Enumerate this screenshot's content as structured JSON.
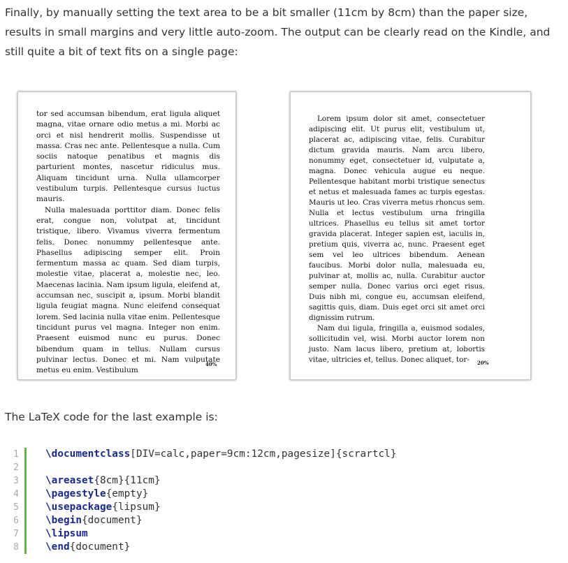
{
  "intro_text": "Finally, by manually setting the text area to be a bit smaller (11cm by 8cm) than the paper size, results in small margins and very little auto-zoom. The output can be clearly read on the Kindle, and still quite a bit of text fits on a single page:",
  "left_page": {
    "paragraphs": [
      {
        "text": "tor sed accumsan bibendum, erat ligula aliquet magna, vitae ornare odio metus a mi. Morbi ac orci et nisl hendrerit mollis. Suspendisse ut massa. Cras nec ante. Pellentesque a nulla. Cum sociis natoque penatibus et magnis dis parturient montes, nascetur ridiculus mus. Aliquam tincidunt urna. Nulla ullamcorper vestibulum turpis. Pellentesque cursus luctus mauris.",
        "indent": false
      },
      {
        "text": "Nulla malesuada porttitor diam. Donec felis erat, congue non, volutpat at, tincidunt tristique, libero. Vivamus viverra fermentum felis. Donec nonummy pellentesque ante. Phasellus adipiscing semper elit. Proin fermentum massa ac quam. Sed diam turpis, molestie vitae, placerat a, molestie nec, leo. Maecenas lacinia. Nam ipsum ligula, eleifend at, accumsan nec, suscipit a, ipsum. Morbi blandit ligula feugiat magna. Nunc eleifend consequat lorem. Sed lacinia nulla vitae enim. Pellentesque tincidunt purus vel magna. Integer non enim. Praesent euismod nunc eu purus. Donec bibendum quam in tellus. Nullam cursus pulvinar lectus. Donec et mi. Nam vulputate metus eu enim. Vestibulum",
        "indent": true
      }
    ],
    "page_number": "40%"
  },
  "right_page": {
    "paragraphs": [
      {
        "text": "Lorem ipsum dolor sit amet, consectetuer adipiscing elit. Ut purus elit, vestibulum ut, placerat ac, adipiscing vitae, felis. Curabitur dictum gravida mauris. Nam arcu libero, nonummy eget, consectetuer id, vulputate a, magna. Donec vehicula augue eu neque. Pellentesque habitant morbi tristique senectus et netus et malesuada fames ac turpis egestas. Mauris ut leo. Cras viverra metus rhoncus sem. Nulla et lectus vestibulum urna fringilla ultrices. Phasellus eu tellus sit amet tortor gravida placerat. Integer sapien est, iaculis in, pretium quis, viverra ac, nunc. Praesent eget sem vel leo ultrices bibendum. Aenean faucibus. Morbi dolor nulla, malesuada eu, pulvinar at, mollis ac, nulla. Curabitur auctor semper nulla. Donec varius orci eget risus. Duis nibh mi, congue eu, accumsan eleifend, sagittis quis, diam. Duis eget orci sit amet orci dignissim rutrum.",
        "indent": true
      },
      {
        "text": "Nam dui ligula, fringilla a, euismod sodales, sollicitudin vel, wisi. Morbi auctor lorem non justo. Nam lacus libero, pretium at, lobortis vitae, ultricies et, tellus. Donec aliquet, tor-",
        "indent": true
      }
    ],
    "page_number": "20%"
  },
  "subheading": "The LaTeX code for the last example is:",
  "code_lines": [
    {
      "n": "1",
      "cmd": "\\documentclass",
      "rest": "[DIV=calc,paper=9cm:12cm,pagesize]{scrartcl}"
    },
    {
      "n": "2",
      "cmd": "",
      "rest": ""
    },
    {
      "n": "3",
      "cmd": "\\areaset",
      "rest": "{8cm}{11cm}"
    },
    {
      "n": "4",
      "cmd": "\\pagestyle",
      "rest": "{empty}"
    },
    {
      "n": "5",
      "cmd": "\\usepackage",
      "rest": "{lipsum}"
    },
    {
      "n": "6",
      "cmd": "\\begin",
      "rest": "{document}"
    },
    {
      "n": "7",
      "cmd": "\\lipsum",
      "rest": ""
    },
    {
      "n": "8",
      "cmd": "\\end",
      "rest": "{document}"
    }
  ],
  "colors": {
    "keyword": "#1b2a8c",
    "gutter_bar": "#6ab04c",
    "text": "#333333"
  }
}
